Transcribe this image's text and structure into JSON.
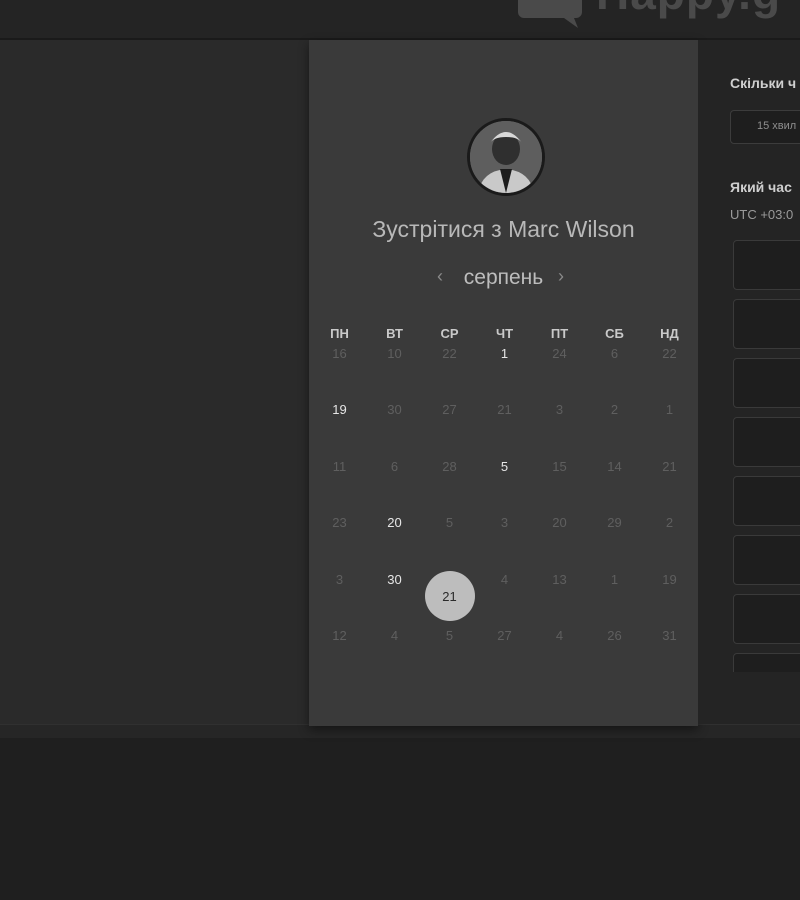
{
  "logo": {
    "text": "Happy.g"
  },
  "card": {
    "title": "Зустрітися з Marc Wilson",
    "month": "серпень",
    "prev_icon": "chevron-left-icon",
    "next_icon": "chevron-right-icon",
    "prev_glyph": "‹",
    "next_glyph": "›",
    "weekdays": [
      "ПН",
      "ВТ",
      "СР",
      "ЧТ",
      "ПТ",
      "СБ",
      "НД"
    ],
    "weeks": [
      [
        "16",
        "10",
        "22",
        "1",
        "24",
        "6",
        "22"
      ],
      [
        "19",
        "30",
        "27",
        "21",
        "3",
        "2",
        "1"
      ],
      [
        "11",
        "6",
        "28",
        "5",
        "15",
        "14",
        "21"
      ],
      [
        "23",
        "20",
        "5",
        "3",
        "20",
        "29",
        "2"
      ],
      [
        "3",
        "30",
        "21",
        "4",
        "13",
        "1",
        "19"
      ],
      [
        "12",
        "4",
        "5",
        "27",
        "4",
        "26",
        "31"
      ]
    ],
    "selected_day": "21"
  },
  "right_panel": {
    "duration_question": "Скільки ч",
    "duration_value": "15 хвил",
    "time_question": "Який час",
    "timezone": "UTC +03:0",
    "slot_count_visible": 8
  }
}
